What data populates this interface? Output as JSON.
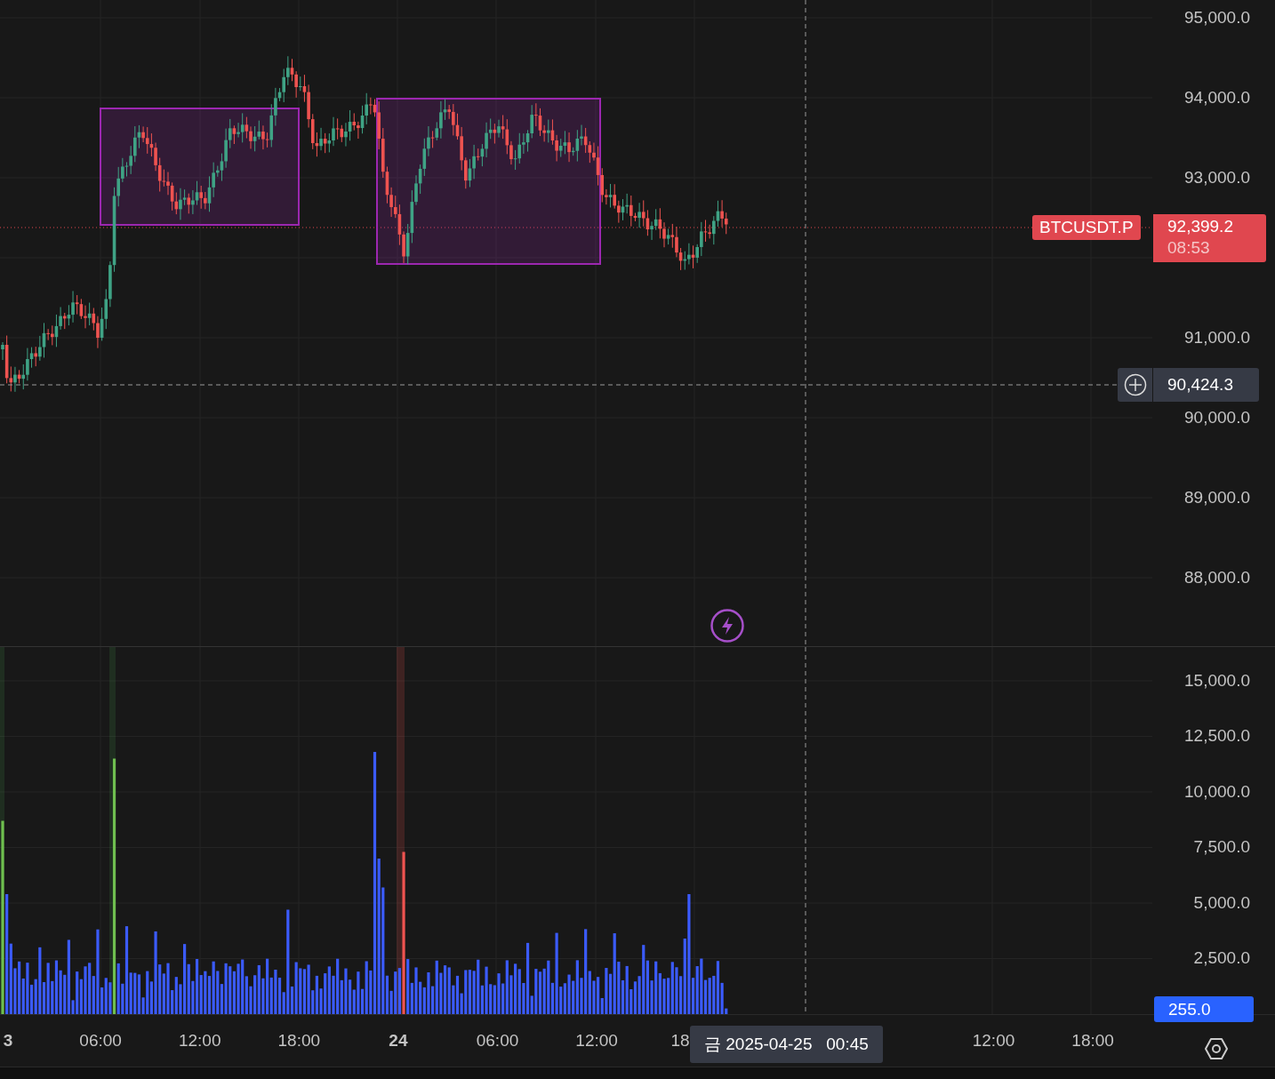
{
  "price_axis": {
    "labels": [
      "95,000.0",
      "94,000.0",
      "93,000.0",
      "91,000.0",
      "90,000.0",
      "89,000.0",
      "88,000.0"
    ]
  },
  "last_price": {
    "symbol": "BTCUSDT.P",
    "price": "92,399.2",
    "countdown": "08:53"
  },
  "crosshair": {
    "price": "90,424.3",
    "time": "금 2025-04-25   00:45"
  },
  "volume_axis": {
    "labels": [
      "15,000.0",
      "12,500.0",
      "10,000.0",
      "7,500.0",
      "5,000.0",
      "2,500.0"
    ],
    "last": "255.0"
  },
  "time_axis": {
    "labels": [
      {
        "text": "3",
        "kind": "day"
      },
      {
        "text": "06:00",
        "kind": "time"
      },
      {
        "text": "12:00",
        "kind": "time"
      },
      {
        "text": "18:00",
        "kind": "time"
      },
      {
        "text": "24",
        "kind": "day"
      },
      {
        "text": "06:00",
        "kind": "time"
      },
      {
        "text": "12:00",
        "kind": "time"
      },
      {
        "text": "18",
        "kind": "time"
      },
      {
        "text": "12:00",
        "kind": "time"
      },
      {
        "text": "18:00",
        "kind": "time"
      }
    ]
  }
}
